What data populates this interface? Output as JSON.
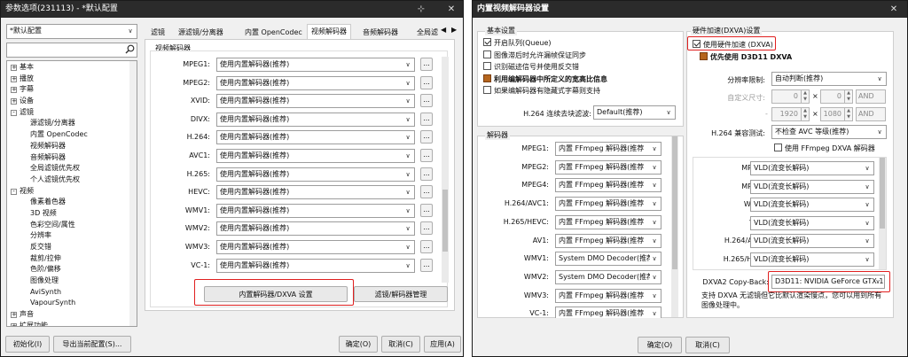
{
  "left": {
    "title": "参数选项(231113) - *默认配置",
    "profile": "*默认配置",
    "search_placeholder": "",
    "tree": [
      {
        "label": "基本",
        "level": 0,
        "pm": "+"
      },
      {
        "label": "播放",
        "level": 0,
        "pm": "+"
      },
      {
        "label": "字幕",
        "level": 0,
        "pm": "+"
      },
      {
        "label": "设备",
        "level": 0,
        "pm": "+"
      },
      {
        "label": "滤镜",
        "level": 0,
        "pm": "-"
      },
      {
        "label": "源滤镜/分离器",
        "level": 1
      },
      {
        "label": "内置 OpenCodec",
        "level": 1
      },
      {
        "label": "视频解码器",
        "level": 1
      },
      {
        "label": "音频解码器",
        "level": 1
      },
      {
        "label": "全局滤镜优先权",
        "level": 1
      },
      {
        "label": "个人滤镜优先权",
        "level": 1
      },
      {
        "label": "视频",
        "level": 0,
        "pm": "-"
      },
      {
        "label": "像素着色器",
        "level": 1
      },
      {
        "label": "3D 视频",
        "level": 1
      },
      {
        "label": "色彩空间/属性",
        "level": 1
      },
      {
        "label": "分辨率",
        "level": 1
      },
      {
        "label": "反交错",
        "level": 1
      },
      {
        "label": "裁剪/拉伸",
        "level": 1
      },
      {
        "label": "色阶/偏移",
        "level": 1
      },
      {
        "label": "图像处理",
        "level": 1
      },
      {
        "label": "AviSynth",
        "level": 1
      },
      {
        "label": "VapourSynth",
        "level": 1
      },
      {
        "label": "声音",
        "level": 0,
        "pm": "+"
      },
      {
        "label": "扩展功能",
        "level": 0,
        "pm": "+"
      }
    ],
    "tabs": [
      "滤镜",
      "源滤镜/分离器",
      "内置 OpenCodec",
      "视频解码器",
      "音频解码器",
      "全局滤"
    ],
    "group_title": "视频解码器",
    "decoders": [
      {
        "label": "MPEG1:",
        "value": "使用内置解码器(推荐)"
      },
      {
        "label": "MPEG2:",
        "value": "使用内置解码器(推荐)"
      },
      {
        "label": "XVID:",
        "value": "使用内置解码器(推荐)"
      },
      {
        "label": "DIVX:",
        "value": "使用内置解码器(推荐)"
      },
      {
        "label": "H.264:",
        "value": "使用内置解码器(推荐)"
      },
      {
        "label": "AVC1:",
        "value": "使用内置解码器(推荐)"
      },
      {
        "label": "H.265:",
        "value": "使用内置解码器(推荐)"
      },
      {
        "label": "HEVC:",
        "value": "使用内置解码器(推荐)"
      },
      {
        "label": "WMV1:",
        "value": "使用内置解码器(推荐)"
      },
      {
        "label": "WMV2:",
        "value": "使用内置解码器(推荐)"
      },
      {
        "label": "WMV3:",
        "value": "使用内置解码器(推荐)"
      },
      {
        "label": "VC-1:",
        "value": "使用内置解码器(推荐)"
      }
    ],
    "dots": "...",
    "btn_dxva": "内置解码器/DXVA 设置",
    "btn_filter_mgr": "滤镜/解码器管理",
    "btn_init": "初始化(I)",
    "btn_export": "导出当前配置(S)...",
    "btn_ok": "确定(O)",
    "btn_cancel": "取消(C)",
    "btn_apply": "应用(A)"
  },
  "right": {
    "title": "内置视频解码器设置",
    "basic_title": "基本设置",
    "checks": [
      {
        "label": "开启队列(Queue)",
        "state": "on"
      },
      {
        "label": "图像滞后时允许漏帧保证同步",
        "state": "off"
      },
      {
        "label": "识别磁迹信号并使用反交错",
        "state": "off"
      },
      {
        "label": "利用编解码器中所定义的宽高比信息",
        "state": "square",
        "bold": true
      },
      {
        "label": "如果编解码器有隐藏式字幕则支持",
        "state": "off"
      }
    ],
    "deblock_label": "H.264 连续去块滤波:",
    "deblock_value": "Default(推荐)",
    "decoder_title": "解码器",
    "decoders": [
      {
        "label": "MPEG1:",
        "value": "内置 FFmpeg 解码器(推荐"
      },
      {
        "label": "MPEG2:",
        "value": "内置 FFmpeg 解码器(推荐"
      },
      {
        "label": "MPEG4:",
        "value": "内置 FFmpeg 解码器(推荐"
      },
      {
        "label": "H.264/AVC1:",
        "value": "内置 FFmpeg 解码器(推荐"
      },
      {
        "label": "H.265/HEVC:",
        "value": "内置 FFmpeg 解码器(推荐"
      },
      {
        "label": "AV1:",
        "value": "内置 FFmpeg 解码器(推荐"
      },
      {
        "label": "WMV1:",
        "value": "System DMO Decoder(推荐"
      },
      {
        "label": "WMV2:",
        "value": "System DMO Decoder(推荐"
      },
      {
        "label": "WMV3:",
        "value": "内置 FFmpeg 解码器(推荐"
      },
      {
        "label": "VC-1:",
        "value": "内置 FFmpeg 解码器(推荐"
      }
    ],
    "hw_title": "硬件加速(DXVA)设置",
    "hw_check": "使用硬件加速 (DXVA)",
    "d3d11_label": "优先使用 D3D11 DXVA",
    "res_limit_label": "分辨率限制:",
    "res_limit_value": "自动判断(推荐)",
    "custom_size_label": "自定义尺寸:",
    "custom_w": "0",
    "custom_h": "0",
    "custom_w2": "1920",
    "custom_h2": "1080",
    "times": "×",
    "dash": "-",
    "and_label": "AND",
    "compat_label": "H.264 兼容测试:",
    "compat_value": "不检查 AVC 等级(推荐)",
    "ffmpeg_dxva": "使用 FFmpeg DXVA 解码器",
    "hw_decoders": [
      {
        "label": "MPEG1:",
        "value": "VLD(流变长解码)"
      },
      {
        "label": "MPEG2:",
        "value": "VLD(流变长解码)"
      },
      {
        "label": "WMV3:",
        "value": "VLD(流变长解码)"
      },
      {
        "label": "VC-1:",
        "value": "VLD(流变长解码)"
      },
      {
        "label": "H.264/AVC1:",
        "value": "VLD(流变长解码)"
      },
      {
        "label": "H.265/HEVC:",
        "value": "VLD(流变长解码)"
      }
    ],
    "copyback_label": "DXVA2 Copy-Back:",
    "copyback_value": "D3D11: NVIDIA GeForce GTX 1",
    "note": "支持 DXVA 无滤镜但它比默认渲染慢点，您可以用到所有图像处理中。",
    "btn_ok": "确定(O)",
    "btn_cancel": "取消(C)"
  },
  "colors": {
    "red_highlight": "#e02020",
    "titlebar": "#2b2b2b",
    "checkbox_square": "#b5651d"
  }
}
